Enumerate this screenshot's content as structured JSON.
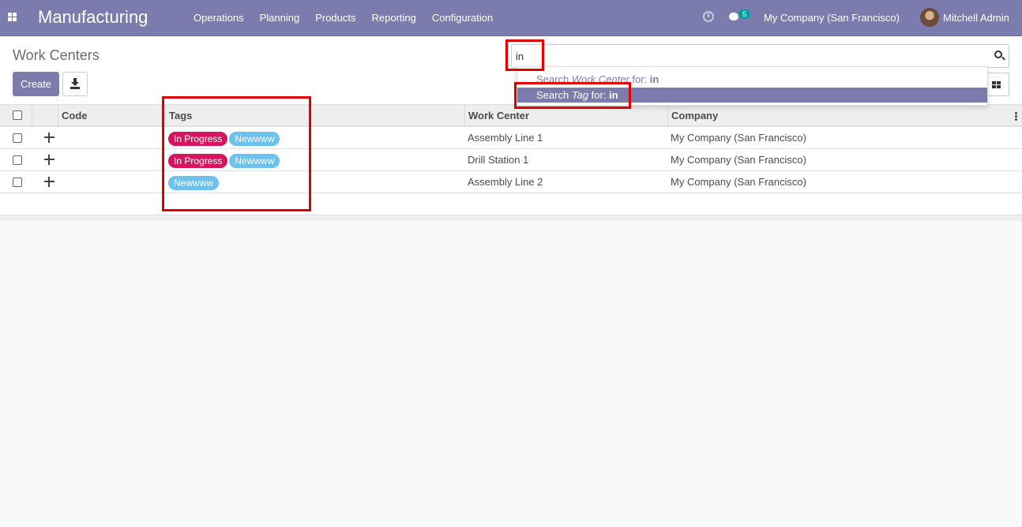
{
  "navbar": {
    "app_title": "Manufacturing",
    "menu": [
      "Operations",
      "Planning",
      "Products",
      "Reporting",
      "Configuration"
    ],
    "chat_count": "5",
    "company": "My Company (San Francisco)",
    "user": "Mitchell Admin"
  },
  "control": {
    "breadcrumb": "Work Centers",
    "create_label": "Create",
    "search_value": "in",
    "dropdown": {
      "item1": {
        "prefix": "Search ",
        "field": "Work Center",
        "middle": " for: ",
        "term": "in"
      },
      "item2": {
        "prefix": "Search ",
        "field": "Tag",
        "middle": " for: ",
        "term": "in"
      }
    }
  },
  "table": {
    "headers": {
      "code": "Code",
      "tags": "Tags",
      "work_center": "Work Center",
      "company": "Company"
    },
    "rows": [
      {
        "code": "",
        "tags": [
          "In Progress",
          "Newwww"
        ],
        "work_center": "Assembly Line 1",
        "company": "My Company (San Francisco)"
      },
      {
        "code": "",
        "tags": [
          "In Progress",
          "Newwww"
        ],
        "work_center": "Drill Station 1",
        "company": "My Company (San Francisco)"
      },
      {
        "code": "",
        "tags": [
          "Newwww"
        ],
        "work_center": "Assembly Line 2",
        "company": "My Company (San Francisco)"
      }
    ]
  },
  "colors": {
    "brand": "#7c7bad",
    "tag_in_progress": "#d6145f",
    "tag_newwww": "#6cc1ed",
    "highlight": "#e00000"
  }
}
